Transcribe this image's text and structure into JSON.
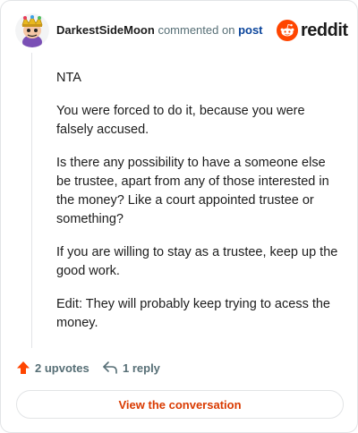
{
  "header": {
    "username": "DarkestSideMoon",
    "commented_text": "commented on",
    "post_link": "post",
    "logo_text": "reddit"
  },
  "comment": {
    "paragraphs": [
      "NTA",
      "You were forced to do it, because you were falsely accused.",
      "Is there any possibility to have a someone else be trustee, apart from any of those interested in the money? Like a court appointed trustee or something?",
      "If you are willing to stay as a trustee, keep up the good work.",
      "Edit: They will probably keep trying to acess the money."
    ]
  },
  "actions": {
    "upvotes_label": "2 upvotes",
    "reply_label": "1 reply"
  },
  "footer": {
    "view_conversation_label": "View the conversation"
  },
  "colors": {
    "brand": "#ff4500",
    "accent_text": "#d93a00",
    "link": "#0a449b",
    "muted": "#576f76"
  }
}
